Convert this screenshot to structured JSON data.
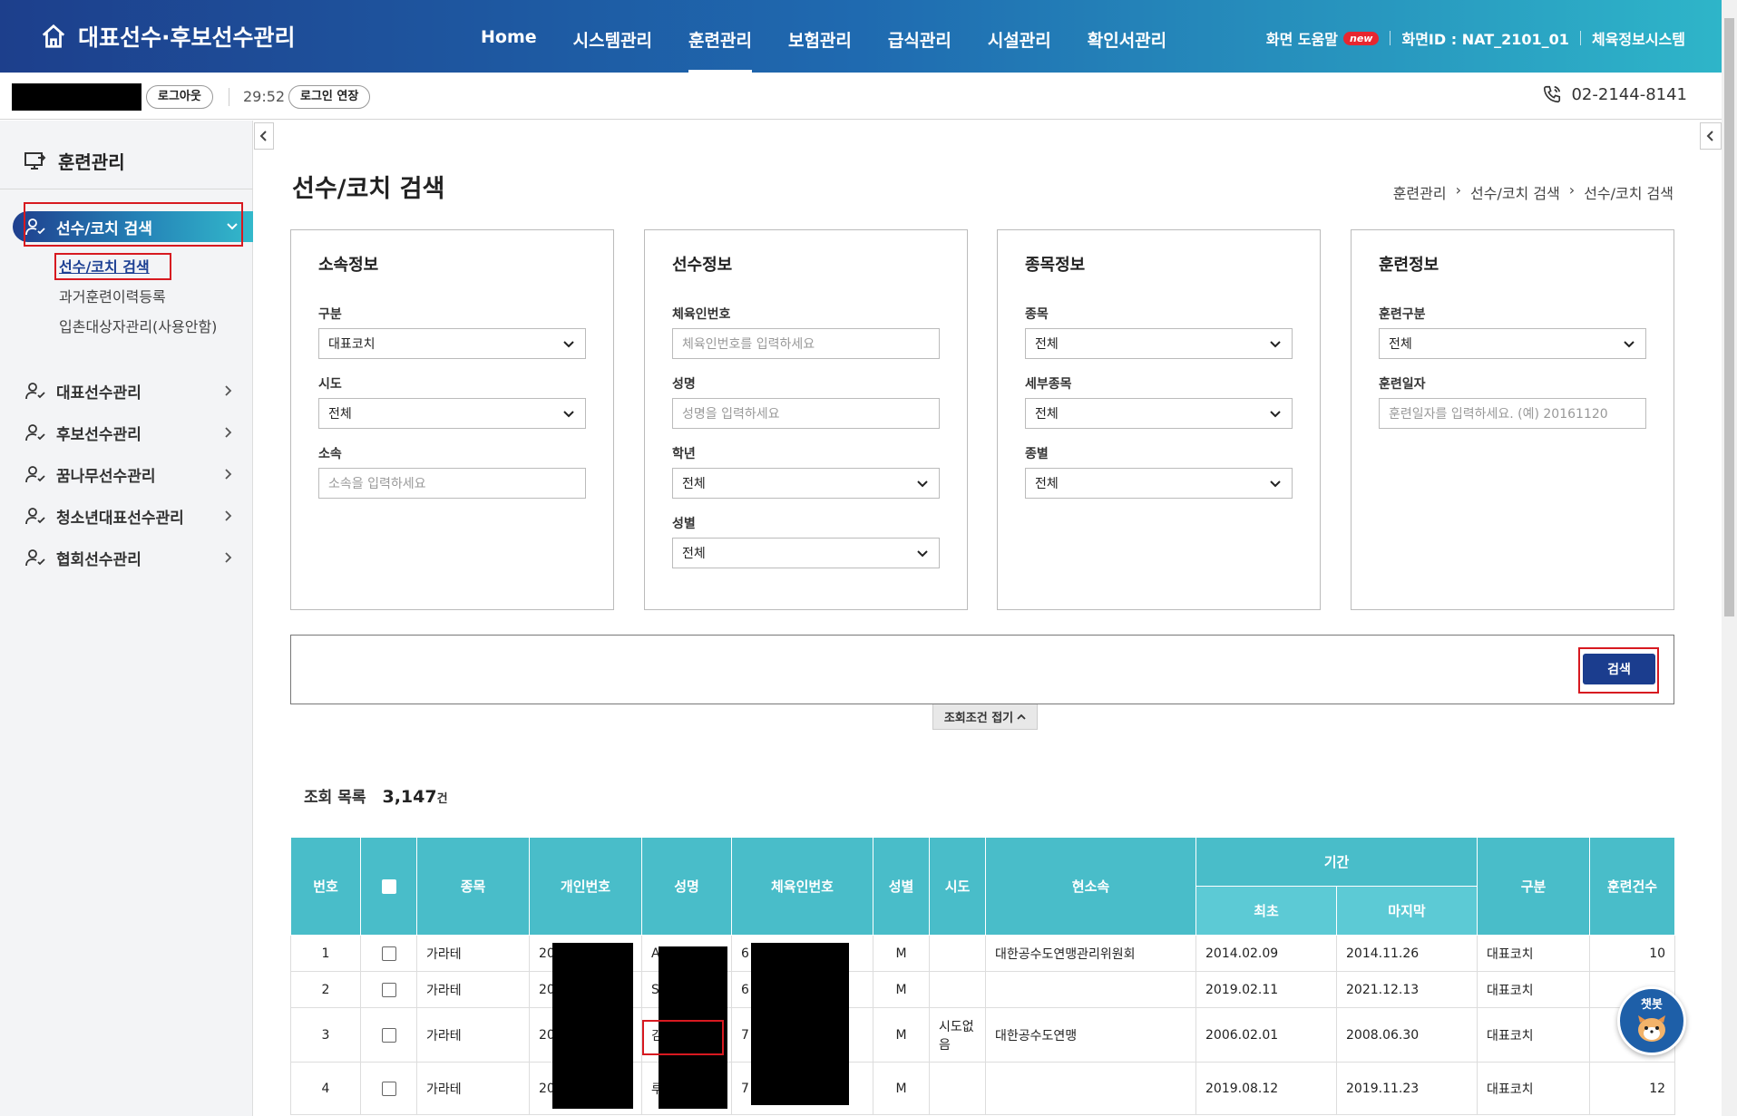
{
  "header": {
    "logo_text": "대표선수·후보선수관리",
    "nav": [
      {
        "label": "Home",
        "active": false
      },
      {
        "label": "시스템관리",
        "active": false
      },
      {
        "label": "훈련관리",
        "active": true
      },
      {
        "label": "보험관리",
        "active": false
      },
      {
        "label": "급식관리",
        "active": false
      },
      {
        "label": "시설관리",
        "active": false
      },
      {
        "label": "확인서관리",
        "active": false
      }
    ],
    "help_label": "화면 도움말",
    "new_badge": "new",
    "screen_id": "화면ID : NAT_2101_01",
    "system_link": "체육정보시스템"
  },
  "subbar": {
    "logout_label": "로그아웃",
    "timer": "29:52",
    "extend_label": "로그인 연장",
    "phone": "02-2144-8141"
  },
  "sidebar": {
    "title": "훈련관리",
    "active_menu": "선수/코치 검색",
    "submenu": [
      {
        "label": "선수/코치 검색",
        "active": true
      },
      {
        "label": "과거훈련이력등록",
        "active": false
      },
      {
        "label": "입촌대상자관리(사용안함)",
        "active": false
      }
    ],
    "menus": [
      {
        "label": "대표선수관리"
      },
      {
        "label": "후보선수관리"
      },
      {
        "label": "꿈나무선수관리"
      },
      {
        "label": "청소년대표선수관리"
      },
      {
        "label": "협회선수관리"
      }
    ]
  },
  "page": {
    "title": "선수/코치 검색",
    "breadcrumb": [
      "훈련관리",
      "선수/코치 검색",
      "선수/코치 검색"
    ]
  },
  "panels": {
    "affiliation": {
      "title": "소속정보",
      "division_label": "구분",
      "division_value": "대표코치",
      "sido_label": "시도",
      "sido_value": "전체",
      "org_label": "소속",
      "org_placeholder": "소속을 입력하세요"
    },
    "athlete": {
      "title": "선수정보",
      "id_label": "체육인번호",
      "id_placeholder": "체육인번호를 입력하세요",
      "name_label": "성명",
      "name_placeholder": "성명을 입력하세요",
      "grade_label": "학년",
      "grade_value": "전체",
      "gender_label": "성별",
      "gender_value": "전체"
    },
    "sport": {
      "title": "종목정보",
      "sport_label": "종목",
      "sport_value": "전체",
      "detail_label": "세부종목",
      "detail_value": "전체",
      "class_label": "종별",
      "class_value": "전체"
    },
    "training": {
      "title": "훈련정보",
      "type_label": "훈련구분",
      "type_value": "전체",
      "date_label": "훈련일자",
      "date_placeholder": "훈련일자를 입력하세요. (예) 20161120"
    }
  },
  "search_button": "검색",
  "fold_button": "조회조건 접기",
  "list": {
    "label": "조회 목록",
    "count": "3,147",
    "unit": "건",
    "columns": {
      "no": "번호",
      "sport": "종목",
      "personal_no": "개인번호",
      "name": "성명",
      "sports_id": "체육인번호",
      "gender": "성별",
      "sido": "시도",
      "org": "현소속",
      "period": "기간",
      "first": "최초",
      "last": "마지막",
      "division": "구분",
      "count": "훈련건수"
    },
    "rows": [
      {
        "no": "1",
        "sport": "가라테",
        "personal_no": "20",
        "name": "A",
        "sports_id": "6",
        "gender": "M",
        "sido": "",
        "org": "대한공수도연맹관리위원회",
        "first": "2014.02.09",
        "last": "2014.11.26",
        "division": "대표코치",
        "count": "10"
      },
      {
        "no": "2",
        "sport": "가라테",
        "personal_no": "20",
        "name": "S",
        "sports_id": "6",
        "gender": "M",
        "sido": "",
        "org": "",
        "first": "2019.02.11",
        "last": "2021.12.13",
        "division": "대표코치",
        "count": ""
      },
      {
        "no": "3",
        "sport": "가라테",
        "personal_no": "20",
        "name": "김",
        "sports_id": "7",
        "gender": "M",
        "sido": "시도없음",
        "org": "대한공수도연맹",
        "first": "2006.02.01",
        "last": "2008.06.30",
        "division": "대표코치",
        "count": ""
      },
      {
        "no": "4",
        "sport": "가라테",
        "personal_no": "20",
        "name": "루 카",
        "sports_id": "7",
        "gender": "M",
        "sido": "",
        "org": "",
        "first": "2019.08.12",
        "last": "2019.11.23",
        "division": "대표코치",
        "count": "12"
      }
    ]
  },
  "chatbot_label": "챗봇"
}
